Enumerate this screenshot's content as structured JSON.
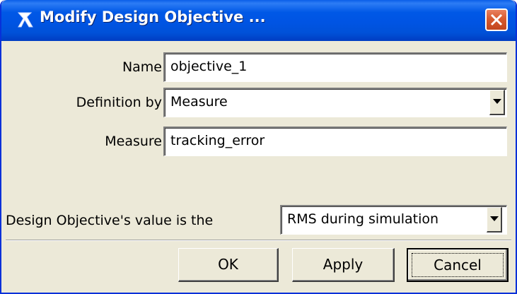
{
  "window": {
    "title": "Modify Design Objective ...",
    "icon": "adams-arrow-icon",
    "close_icon": "close-icon"
  },
  "form": {
    "name_label": "Name",
    "name_value": "objective_1",
    "definition_label": "Definition by",
    "definition_value": "Measure",
    "measure_label": "Measure",
    "measure_value": "tracking_error",
    "value_label": "Design Objective's value is the",
    "value_selected": "RMS during simulation"
  },
  "buttons": {
    "ok": "OK",
    "apply": "Apply",
    "cancel": "Cancel"
  },
  "colors": {
    "titlebar": "#0054e3",
    "dialog_bg": "#ece9d8",
    "close_button": "#d75a2f"
  }
}
